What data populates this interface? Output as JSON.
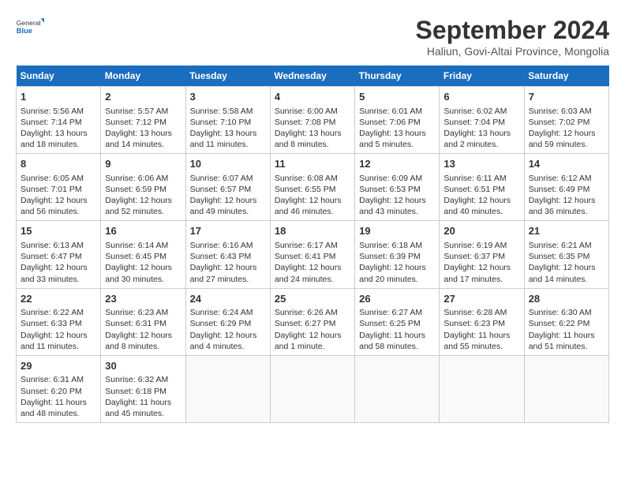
{
  "logo": {
    "general": "General",
    "blue": "Blue"
  },
  "title": "September 2024",
  "subtitle": "Haliun, Govi-Altai Province, Mongolia",
  "headers": [
    "Sunday",
    "Monday",
    "Tuesday",
    "Wednesday",
    "Thursday",
    "Friday",
    "Saturday"
  ],
  "weeks": [
    [
      {
        "day": "1",
        "lines": [
          "Sunrise: 5:56 AM",
          "Sunset: 7:14 PM",
          "Daylight: 13 hours",
          "and 18 minutes."
        ]
      },
      {
        "day": "2",
        "lines": [
          "Sunrise: 5:57 AM",
          "Sunset: 7:12 PM",
          "Daylight: 13 hours",
          "and 14 minutes."
        ]
      },
      {
        "day": "3",
        "lines": [
          "Sunrise: 5:58 AM",
          "Sunset: 7:10 PM",
          "Daylight: 13 hours",
          "and 11 minutes."
        ]
      },
      {
        "day": "4",
        "lines": [
          "Sunrise: 6:00 AM",
          "Sunset: 7:08 PM",
          "Daylight: 13 hours",
          "and 8 minutes."
        ]
      },
      {
        "day": "5",
        "lines": [
          "Sunrise: 6:01 AM",
          "Sunset: 7:06 PM",
          "Daylight: 13 hours",
          "and 5 minutes."
        ]
      },
      {
        "day": "6",
        "lines": [
          "Sunrise: 6:02 AM",
          "Sunset: 7:04 PM",
          "Daylight: 13 hours",
          "and 2 minutes."
        ]
      },
      {
        "day": "7",
        "lines": [
          "Sunrise: 6:03 AM",
          "Sunset: 7:02 PM",
          "Daylight: 12 hours",
          "and 59 minutes."
        ]
      }
    ],
    [
      {
        "day": "8",
        "lines": [
          "Sunrise: 6:05 AM",
          "Sunset: 7:01 PM",
          "Daylight: 12 hours",
          "and 56 minutes."
        ]
      },
      {
        "day": "9",
        "lines": [
          "Sunrise: 6:06 AM",
          "Sunset: 6:59 PM",
          "Daylight: 12 hours",
          "and 52 minutes."
        ]
      },
      {
        "day": "10",
        "lines": [
          "Sunrise: 6:07 AM",
          "Sunset: 6:57 PM",
          "Daylight: 12 hours",
          "and 49 minutes."
        ]
      },
      {
        "day": "11",
        "lines": [
          "Sunrise: 6:08 AM",
          "Sunset: 6:55 PM",
          "Daylight: 12 hours",
          "and 46 minutes."
        ]
      },
      {
        "day": "12",
        "lines": [
          "Sunrise: 6:09 AM",
          "Sunset: 6:53 PM",
          "Daylight: 12 hours",
          "and 43 minutes."
        ]
      },
      {
        "day": "13",
        "lines": [
          "Sunrise: 6:11 AM",
          "Sunset: 6:51 PM",
          "Daylight: 12 hours",
          "and 40 minutes."
        ]
      },
      {
        "day": "14",
        "lines": [
          "Sunrise: 6:12 AM",
          "Sunset: 6:49 PM",
          "Daylight: 12 hours",
          "and 36 minutes."
        ]
      }
    ],
    [
      {
        "day": "15",
        "lines": [
          "Sunrise: 6:13 AM",
          "Sunset: 6:47 PM",
          "Daylight: 12 hours",
          "and 33 minutes."
        ]
      },
      {
        "day": "16",
        "lines": [
          "Sunrise: 6:14 AM",
          "Sunset: 6:45 PM",
          "Daylight: 12 hours",
          "and 30 minutes."
        ]
      },
      {
        "day": "17",
        "lines": [
          "Sunrise: 6:16 AM",
          "Sunset: 6:43 PM",
          "Daylight: 12 hours",
          "and 27 minutes."
        ]
      },
      {
        "day": "18",
        "lines": [
          "Sunrise: 6:17 AM",
          "Sunset: 6:41 PM",
          "Daylight: 12 hours",
          "and 24 minutes."
        ]
      },
      {
        "day": "19",
        "lines": [
          "Sunrise: 6:18 AM",
          "Sunset: 6:39 PM",
          "Daylight: 12 hours",
          "and 20 minutes."
        ]
      },
      {
        "day": "20",
        "lines": [
          "Sunrise: 6:19 AM",
          "Sunset: 6:37 PM",
          "Daylight: 12 hours",
          "and 17 minutes."
        ]
      },
      {
        "day": "21",
        "lines": [
          "Sunrise: 6:21 AM",
          "Sunset: 6:35 PM",
          "Daylight: 12 hours",
          "and 14 minutes."
        ]
      }
    ],
    [
      {
        "day": "22",
        "lines": [
          "Sunrise: 6:22 AM",
          "Sunset: 6:33 PM",
          "Daylight: 12 hours",
          "and 11 minutes."
        ]
      },
      {
        "day": "23",
        "lines": [
          "Sunrise: 6:23 AM",
          "Sunset: 6:31 PM",
          "Daylight: 12 hours",
          "and 8 minutes."
        ]
      },
      {
        "day": "24",
        "lines": [
          "Sunrise: 6:24 AM",
          "Sunset: 6:29 PM",
          "Daylight: 12 hours",
          "and 4 minutes."
        ]
      },
      {
        "day": "25",
        "lines": [
          "Sunrise: 6:26 AM",
          "Sunset: 6:27 PM",
          "Daylight: 12 hours",
          "and 1 minute."
        ]
      },
      {
        "day": "26",
        "lines": [
          "Sunrise: 6:27 AM",
          "Sunset: 6:25 PM",
          "Daylight: 11 hours",
          "and 58 minutes."
        ]
      },
      {
        "day": "27",
        "lines": [
          "Sunrise: 6:28 AM",
          "Sunset: 6:23 PM",
          "Daylight: 11 hours",
          "and 55 minutes."
        ]
      },
      {
        "day": "28",
        "lines": [
          "Sunrise: 6:30 AM",
          "Sunset: 6:22 PM",
          "Daylight: 11 hours",
          "and 51 minutes."
        ]
      }
    ],
    [
      {
        "day": "29",
        "lines": [
          "Sunrise: 6:31 AM",
          "Sunset: 6:20 PM",
          "Daylight: 11 hours",
          "and 48 minutes."
        ]
      },
      {
        "day": "30",
        "lines": [
          "Sunrise: 6:32 AM",
          "Sunset: 6:18 PM",
          "Daylight: 11 hours",
          "and 45 minutes."
        ]
      },
      {
        "day": "",
        "lines": [],
        "empty": true
      },
      {
        "day": "",
        "lines": [],
        "empty": true
      },
      {
        "day": "",
        "lines": [],
        "empty": true
      },
      {
        "day": "",
        "lines": [],
        "empty": true
      },
      {
        "day": "",
        "lines": [],
        "empty": true
      }
    ]
  ]
}
